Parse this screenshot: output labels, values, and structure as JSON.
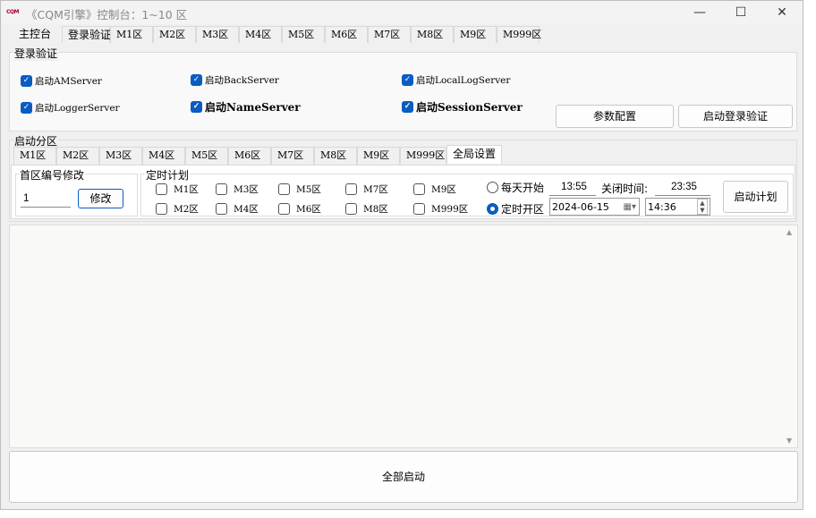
{
  "window": {
    "logo": "CQM",
    "title": "《CQM引擎》控制台：1~10 区",
    "minimize": "—",
    "maximize": "☐",
    "close": "✕"
  },
  "main_tabs": [
    "主控台",
    "登录验证",
    "M1区",
    "M2区",
    "M3区",
    "M4区",
    "M5区",
    "M6区",
    "M7区",
    "M8区",
    "M9区",
    "M999区"
  ],
  "login_group": {
    "label": "登录验证",
    "checkboxes": [
      {
        "label": "启动AMServer",
        "checked": true
      },
      {
        "label": "启动BackServer",
        "checked": true
      },
      {
        "label": "启动LocalLogServer",
        "checked": true
      },
      {
        "label": "启动LoggerServer",
        "checked": true
      },
      {
        "label": "启动NameServer",
        "checked": true
      },
      {
        "label": "启动SessionServer",
        "checked": true
      }
    ],
    "param_button": "参数配置",
    "start_login_button": "启动登录验证"
  },
  "zone_group": {
    "label": "启动分区",
    "tabs": [
      "M1区",
      "M2区",
      "M3区",
      "M4区",
      "M5区",
      "M6区",
      "M7区",
      "M8区",
      "M9区",
      "M999区",
      "全局设置"
    ],
    "first_zone": {
      "label": "首区编号修改",
      "value": "1",
      "button": "修改"
    },
    "schedule": {
      "label": "定时计划",
      "zones": [
        {
          "label": "M1区",
          "checked": false
        },
        {
          "label": "M2区",
          "checked": false
        },
        {
          "label": "M3区",
          "checked": false
        },
        {
          "label": "M4区",
          "checked": false
        },
        {
          "label": "M5区",
          "checked": false
        },
        {
          "label": "M6区",
          "checked": false
        },
        {
          "label": "M7区",
          "checked": false
        },
        {
          "label": "M8区",
          "checked": false
        },
        {
          "label": "M9区",
          "checked": false
        },
        {
          "label": "M999区",
          "checked": false
        }
      ],
      "daily_label": "每天开始",
      "daily_selected": false,
      "daily_time": "13:55",
      "close_label": "关闭时间:",
      "close_time": "23:35",
      "timed_label": "定时开区",
      "timed_selected": true,
      "date": "2024-06-15",
      "time": "14:36",
      "start_button": "启动计划"
    }
  },
  "start_all_button": "全部启动",
  "colors": {
    "accent": "#0a5cc2"
  }
}
